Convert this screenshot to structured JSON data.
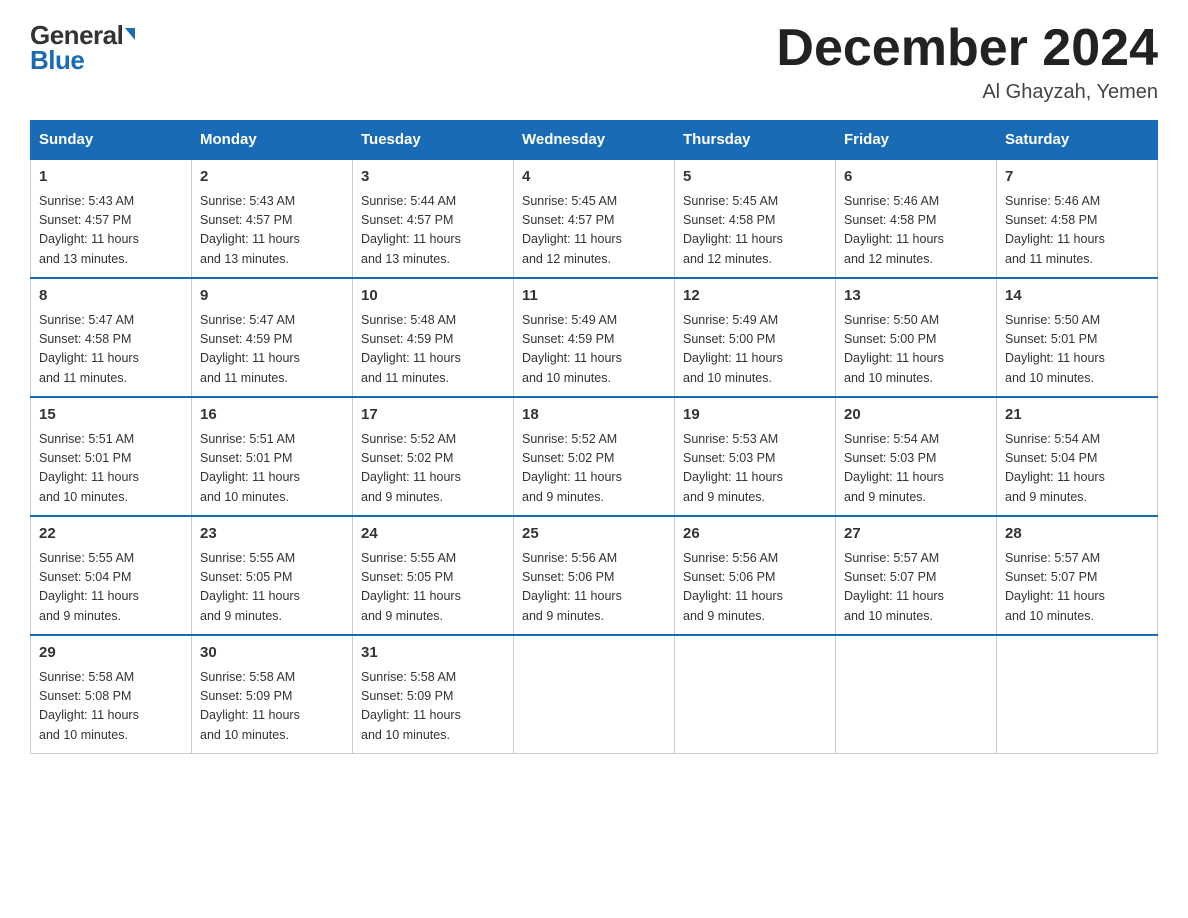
{
  "logo": {
    "general": "General",
    "blue": "Blue",
    "alt": "GeneralBlue logo"
  },
  "title": "December 2024",
  "location": "Al Ghayzah, Yemen",
  "days_of_week": [
    "Sunday",
    "Monday",
    "Tuesday",
    "Wednesday",
    "Thursday",
    "Friday",
    "Saturday"
  ],
  "weeks": [
    [
      {
        "day": "1",
        "info": "Sunrise: 5:43 AM\nSunset: 4:57 PM\nDaylight: 11 hours\nand 13 minutes."
      },
      {
        "day": "2",
        "info": "Sunrise: 5:43 AM\nSunset: 4:57 PM\nDaylight: 11 hours\nand 13 minutes."
      },
      {
        "day": "3",
        "info": "Sunrise: 5:44 AM\nSunset: 4:57 PM\nDaylight: 11 hours\nand 13 minutes."
      },
      {
        "day": "4",
        "info": "Sunrise: 5:45 AM\nSunset: 4:57 PM\nDaylight: 11 hours\nand 12 minutes."
      },
      {
        "day": "5",
        "info": "Sunrise: 5:45 AM\nSunset: 4:58 PM\nDaylight: 11 hours\nand 12 minutes."
      },
      {
        "day": "6",
        "info": "Sunrise: 5:46 AM\nSunset: 4:58 PM\nDaylight: 11 hours\nand 12 minutes."
      },
      {
        "day": "7",
        "info": "Sunrise: 5:46 AM\nSunset: 4:58 PM\nDaylight: 11 hours\nand 11 minutes."
      }
    ],
    [
      {
        "day": "8",
        "info": "Sunrise: 5:47 AM\nSunset: 4:58 PM\nDaylight: 11 hours\nand 11 minutes."
      },
      {
        "day": "9",
        "info": "Sunrise: 5:47 AM\nSunset: 4:59 PM\nDaylight: 11 hours\nand 11 minutes."
      },
      {
        "day": "10",
        "info": "Sunrise: 5:48 AM\nSunset: 4:59 PM\nDaylight: 11 hours\nand 11 minutes."
      },
      {
        "day": "11",
        "info": "Sunrise: 5:49 AM\nSunset: 4:59 PM\nDaylight: 11 hours\nand 10 minutes."
      },
      {
        "day": "12",
        "info": "Sunrise: 5:49 AM\nSunset: 5:00 PM\nDaylight: 11 hours\nand 10 minutes."
      },
      {
        "day": "13",
        "info": "Sunrise: 5:50 AM\nSunset: 5:00 PM\nDaylight: 11 hours\nand 10 minutes."
      },
      {
        "day": "14",
        "info": "Sunrise: 5:50 AM\nSunset: 5:01 PM\nDaylight: 11 hours\nand 10 minutes."
      }
    ],
    [
      {
        "day": "15",
        "info": "Sunrise: 5:51 AM\nSunset: 5:01 PM\nDaylight: 11 hours\nand 10 minutes."
      },
      {
        "day": "16",
        "info": "Sunrise: 5:51 AM\nSunset: 5:01 PM\nDaylight: 11 hours\nand 10 minutes."
      },
      {
        "day": "17",
        "info": "Sunrise: 5:52 AM\nSunset: 5:02 PM\nDaylight: 11 hours\nand 9 minutes."
      },
      {
        "day": "18",
        "info": "Sunrise: 5:52 AM\nSunset: 5:02 PM\nDaylight: 11 hours\nand 9 minutes."
      },
      {
        "day": "19",
        "info": "Sunrise: 5:53 AM\nSunset: 5:03 PM\nDaylight: 11 hours\nand 9 minutes."
      },
      {
        "day": "20",
        "info": "Sunrise: 5:54 AM\nSunset: 5:03 PM\nDaylight: 11 hours\nand 9 minutes."
      },
      {
        "day": "21",
        "info": "Sunrise: 5:54 AM\nSunset: 5:04 PM\nDaylight: 11 hours\nand 9 minutes."
      }
    ],
    [
      {
        "day": "22",
        "info": "Sunrise: 5:55 AM\nSunset: 5:04 PM\nDaylight: 11 hours\nand 9 minutes."
      },
      {
        "day": "23",
        "info": "Sunrise: 5:55 AM\nSunset: 5:05 PM\nDaylight: 11 hours\nand 9 minutes."
      },
      {
        "day": "24",
        "info": "Sunrise: 5:55 AM\nSunset: 5:05 PM\nDaylight: 11 hours\nand 9 minutes."
      },
      {
        "day": "25",
        "info": "Sunrise: 5:56 AM\nSunset: 5:06 PM\nDaylight: 11 hours\nand 9 minutes."
      },
      {
        "day": "26",
        "info": "Sunrise: 5:56 AM\nSunset: 5:06 PM\nDaylight: 11 hours\nand 9 minutes."
      },
      {
        "day": "27",
        "info": "Sunrise: 5:57 AM\nSunset: 5:07 PM\nDaylight: 11 hours\nand 10 minutes."
      },
      {
        "day": "28",
        "info": "Sunrise: 5:57 AM\nSunset: 5:07 PM\nDaylight: 11 hours\nand 10 minutes."
      }
    ],
    [
      {
        "day": "29",
        "info": "Sunrise: 5:58 AM\nSunset: 5:08 PM\nDaylight: 11 hours\nand 10 minutes."
      },
      {
        "day": "30",
        "info": "Sunrise: 5:58 AM\nSunset: 5:09 PM\nDaylight: 11 hours\nand 10 minutes."
      },
      {
        "day": "31",
        "info": "Sunrise: 5:58 AM\nSunset: 5:09 PM\nDaylight: 11 hours\nand 10 minutes."
      },
      {
        "day": "",
        "info": ""
      },
      {
        "day": "",
        "info": ""
      },
      {
        "day": "",
        "info": ""
      },
      {
        "day": "",
        "info": ""
      }
    ]
  ]
}
